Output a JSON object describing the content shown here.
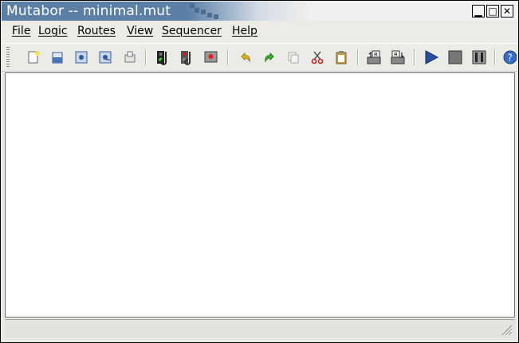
{
  "window": {
    "title": "Mutabor -- minimal.mut"
  },
  "window_controls": {
    "minimize": "▁",
    "maximize": "□",
    "close": "✕"
  },
  "menu": [
    "File",
    "Logic",
    "Routes",
    "View",
    "Sequencer",
    "Help"
  ],
  "toolbar_icons": [
    "new-file-icon",
    "open-file-icon",
    "save-file-icon",
    "save-as-icon",
    "execute-icon",
    "activate-logic-icon",
    "stop-logic-icon",
    "panic-icon",
    "undo-icon",
    "redo-icon",
    "copy-icon",
    "cut-icon",
    "paste-icon",
    "route-load-icon",
    "route-save-icon",
    "play-icon",
    "stop-icon",
    "pause-icon",
    "help-icon"
  ],
  "status": {
    "text": ""
  },
  "colors": {
    "titlebar": "#5c7fa6",
    "client": "#ffffff",
    "chrome": "#ebebe8"
  }
}
